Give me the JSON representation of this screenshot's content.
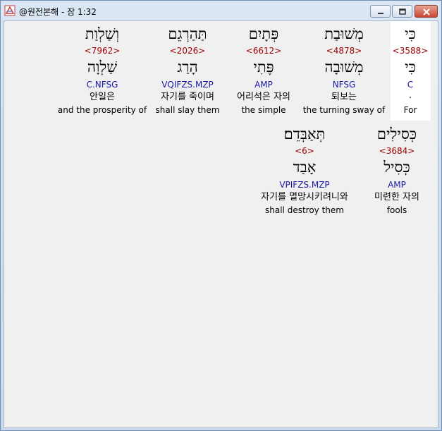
{
  "window": {
    "title": "@원전본해 - 잠 1:32"
  },
  "rows": [
    [
      {
        "hebrew": "כִּי",
        "strong": "<3588>",
        "lemma": "כִּי",
        "morph": "C",
        "korean": ".",
        "english": "For"
      },
      {
        "hebrew": "מְשׁוּבַת",
        "strong": "<4878>",
        "lemma": "מְשׁוּבָה",
        "morph": "NFSG",
        "korean": "퇴보는",
        "english": "the turning sway of"
      },
      {
        "hebrew": "פְּתָיִם",
        "strong": "<6612>",
        "lemma": "פֶּתִי",
        "morph": "AMP",
        "korean": "어리석은 자의",
        "english": "the simple"
      },
      {
        "hebrew": "תַּהַרְגֵם",
        "strong": "<2026>",
        "lemma": "הָרַג",
        "morph": "VQIFZS.MZP",
        "korean": "자기를 죽이며",
        "english": "shall slay them"
      },
      {
        "hebrew": "וְשַׁלְוַת",
        "strong": "<7962>",
        "lemma": "שַׁלְוָה",
        "morph": "C.NFSG",
        "korean": "안일은",
        "english": "and the prosperity of"
      }
    ],
    [
      {
        "hebrew": "כְּסִילִים",
        "strong": "<3684>",
        "lemma": "כְּסִיל",
        "morph": "AMP",
        "korean": "미련한 자의",
        "english": "fools"
      },
      {
        "hebrew": "תְּאַבְּדֵם׃",
        "strong": "<6>",
        "lemma": "אָבַד",
        "morph": "VPIFZS.MZP",
        "korean": "자기를 멸망시키려니와",
        "english": "shall destroy them"
      }
    ]
  ]
}
